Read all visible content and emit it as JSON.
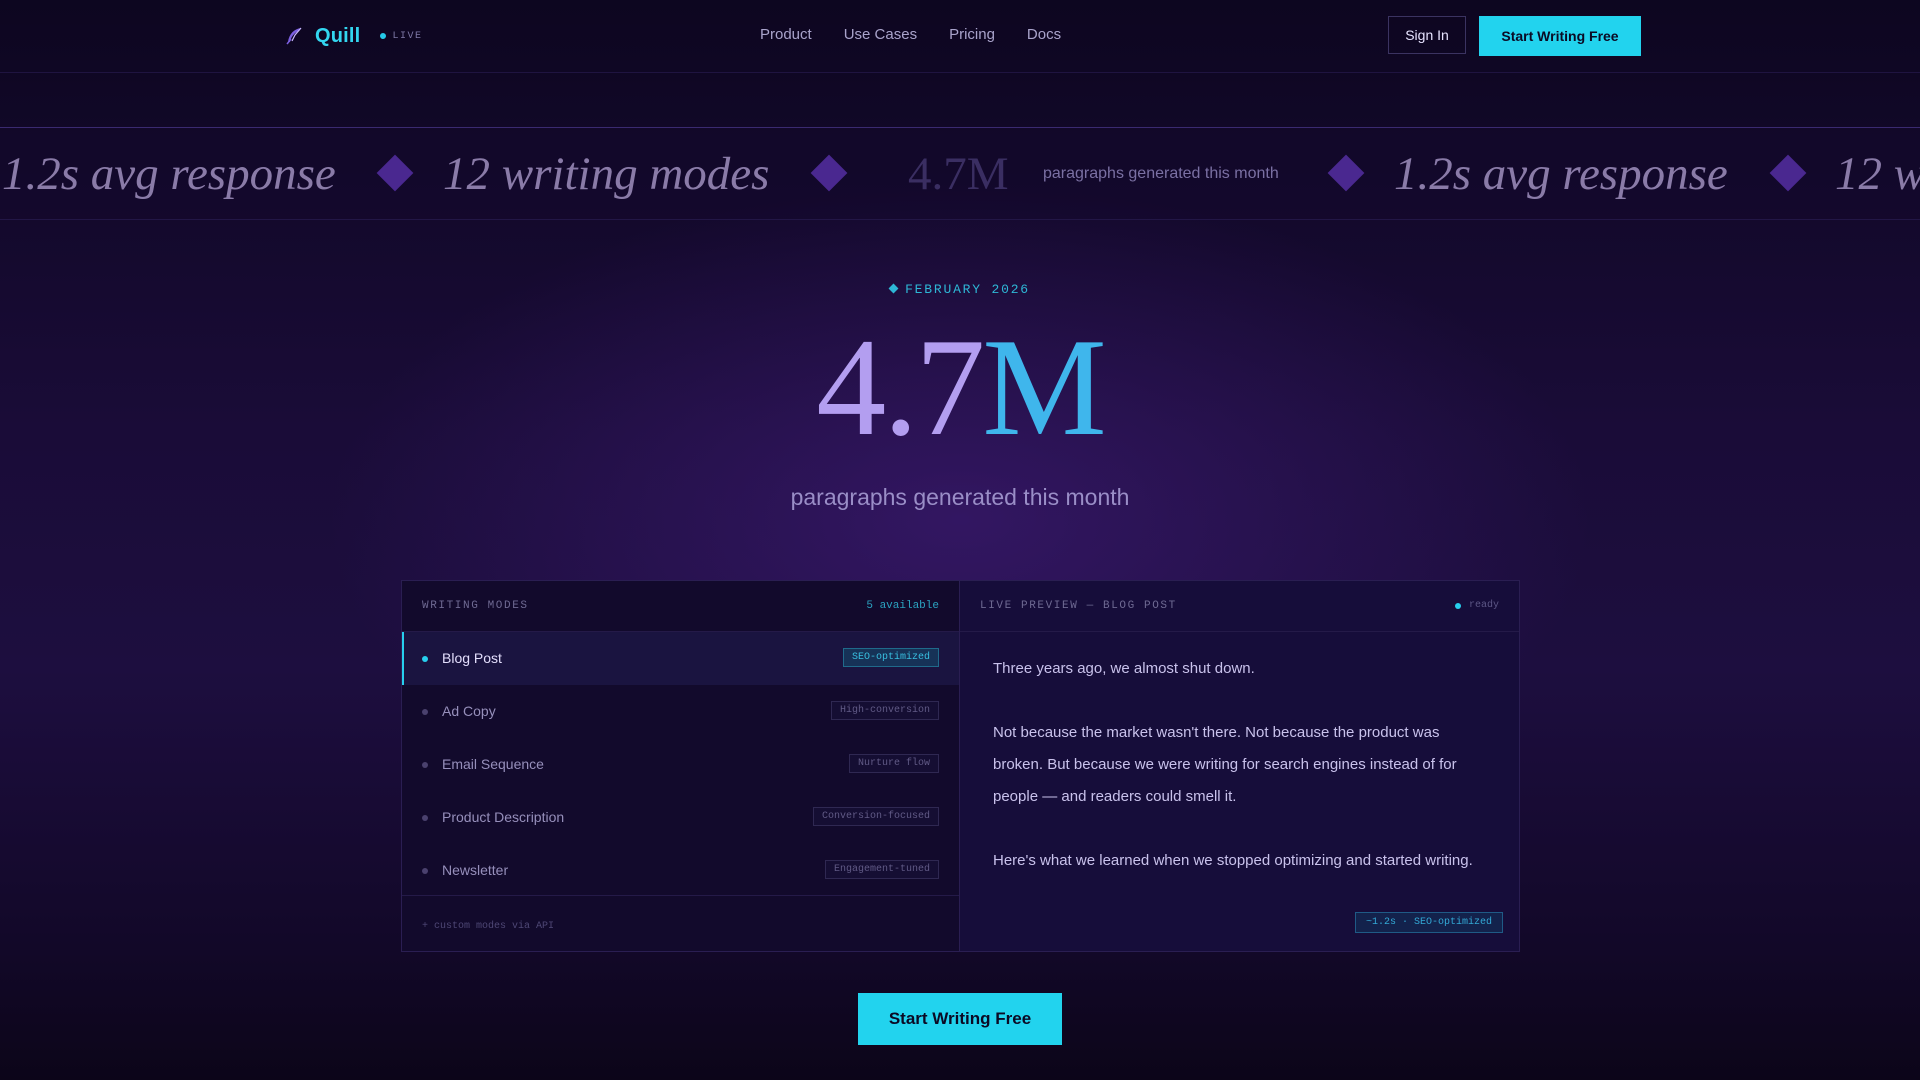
{
  "brand": {
    "name": "Quill",
    "live_label": "LIVE"
  },
  "nav": {
    "links": [
      "Product",
      "Use Cases",
      "Pricing",
      "Docs"
    ],
    "sign_in": "Sign In",
    "cta": "Start Writing Free"
  },
  "ticker": {
    "avg_response": "1.2s avg response",
    "modes": "12 writing modes",
    "stat_value": "4.7M",
    "stat_label": "paragraphs generated this month",
    "trailing": "12 w"
  },
  "hero": {
    "date": "FEBRUARY 2026",
    "value_part1": "4.7",
    "value_part2": "M",
    "subtitle": "paragraphs generated this month"
  },
  "modes_panel": {
    "title": "WRITING MODES",
    "available": "5 available",
    "items": [
      {
        "label": "Blog Post",
        "tag": "SEO-optimized"
      },
      {
        "label": "Ad Copy",
        "tag": "High-conversion"
      },
      {
        "label": "Email Sequence",
        "tag": "Nurture flow"
      },
      {
        "label": "Product Description",
        "tag": "Conversion-focused"
      },
      {
        "label": "Newsletter",
        "tag": "Engagement-tuned"
      }
    ],
    "footer": "+ custom modes via API"
  },
  "preview_panel": {
    "title": "LIVE PREVIEW — BLOG POST",
    "status": "ready",
    "paragraphs": [
      "Three years ago, we almost shut down.",
      "Not because the market wasn't there. Not because the product was broken. But because we were writing for search engines instead of for people — and readers could smell it.",
      "Here's what we learned when we stopped optimizing and started writing."
    ],
    "badge": "~1.2s · SEO-optimized"
  },
  "main_cta": "Start Writing Free"
}
